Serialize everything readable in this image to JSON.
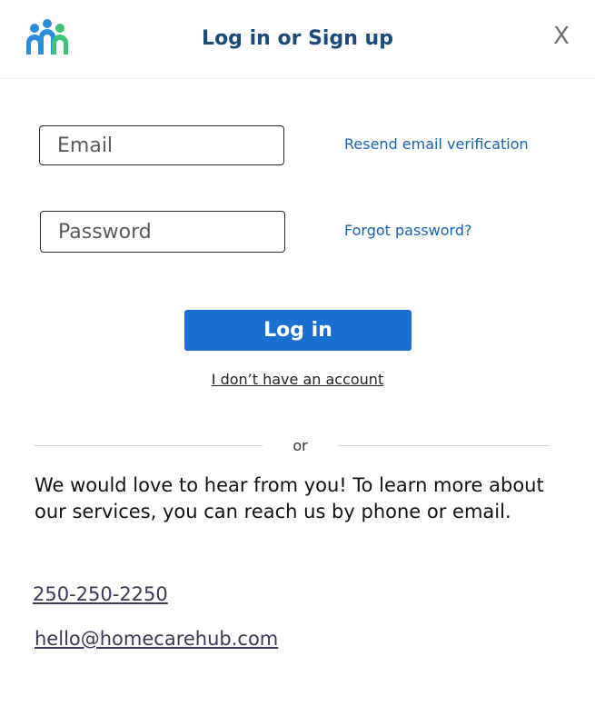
{
  "header": {
    "title": "Log in or Sign up",
    "close_label": "X",
    "logo_icon": "family-logo-icon",
    "colors": {
      "blue": "#2a8fd8",
      "green": "#3cc47c"
    }
  },
  "form": {
    "email_placeholder": "Email",
    "password_placeholder": "Password",
    "resend_link": "Resend email verification",
    "forgot_link": "Forgot password?",
    "login_button": "Log in",
    "no_account_link": "I don’t have an account"
  },
  "divider": {
    "label": "or"
  },
  "contact": {
    "message": "We would love to hear from you! To learn more about our services, you can reach us by phone or email.",
    "phone": "250-250-2250",
    "email": "hello@homecarehub.com"
  },
  "colors": {
    "title": "#1a4a7a",
    "link": "#1a63b0",
    "button": "#1a6ed0"
  }
}
